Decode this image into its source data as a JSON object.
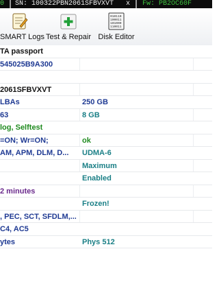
{
  "topbar": {
    "left": "0",
    "serial": "SN: 100322PBN2061SFBVXVT",
    "close": "x",
    "firmware": "Fw: PB2OC60F"
  },
  "toolbar": {
    "smart_logs": "SMART Logs",
    "test_repair": "Test & Repair",
    "disk_editor": "Disk Editor",
    "disk_editor_icon_text": [
      "010110",
      "100011",
      "101000",
      "110011"
    ]
  },
  "rows": [
    {
      "c1": "TA passport",
      "c2": ""
    },
    {
      "c1": "545025B9A300",
      "c2": ""
    },
    {
      "c1": "",
      "c2": ""
    },
    {
      "c1": "2061SFBVXVT",
      "c2": ""
    },
    {
      "c1": " LBAs",
      "c2": "250 GB"
    },
    {
      "c1": "63",
      "c2": "8 GB"
    },
    {
      "c1": "log, Selftest",
      "c2": ""
    },
    {
      "c1": "=ON; Wr=ON;",
      "c2": "ok"
    },
    {
      "c1": "AM, APM, DLM, D...",
      "c2": "UDMA-6"
    },
    {
      "c1": "",
      "c2": "Maximum"
    },
    {
      "c1": "",
      "c2": "Enabled"
    },
    {
      "c1": "2 minutes",
      "c2": ""
    },
    {
      "c1": "",
      "c2": "Frozen!"
    },
    {
      "c1": ", PEC, SCT, SFDLM,...",
      "c2": ""
    },
    {
      "c1": "C4, AC5",
      "c2": ""
    },
    {
      "c1": "ytes",
      "c2": "Phys 512"
    }
  ],
  "colors": {
    "blue": "#1f3a93",
    "green": "#1f8a1f",
    "teal": "#1a7f86",
    "purple": "#6a2a8c"
  }
}
